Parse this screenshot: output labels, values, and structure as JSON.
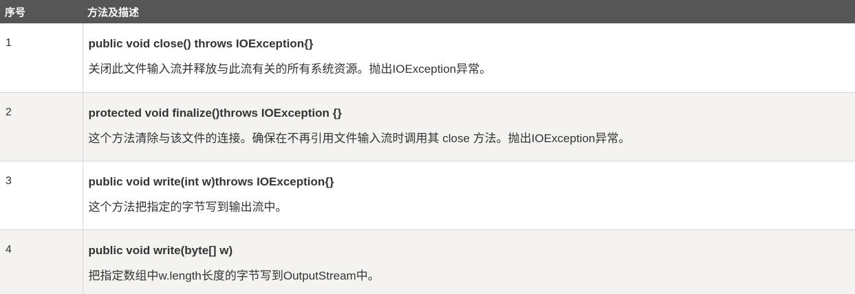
{
  "table": {
    "header": {
      "col_no": "序号",
      "col_desc": "方法及描述"
    },
    "rows": [
      {
        "no": "1",
        "signature": "public void close() throws IOException{}",
        "description": "关闭此文件输入流并释放与此流有关的所有系统资源。抛出IOException异常。"
      },
      {
        "no": "2",
        "signature": "protected void finalize()throws IOException {}",
        "description": "这个方法清除与该文件的连接。确保在不再引用文件输入流时调用其 close 方法。抛出IOException异常。"
      },
      {
        "no": "3",
        "signature": "public void write(int w)throws IOException{}",
        "description": "这个方法把指定的字节写到输出流中。"
      },
      {
        "no": "4",
        "signature": "public void write(byte[] w)",
        "description": "把指定数组中w.length长度的字节写到OutputStream中。"
      }
    ]
  },
  "colors": {
    "header_bg": "#555555",
    "header_text": "#ffffff",
    "row_alt_bg": "#f4f3f0",
    "border": "#d4d4d4",
    "text": "#333333"
  }
}
